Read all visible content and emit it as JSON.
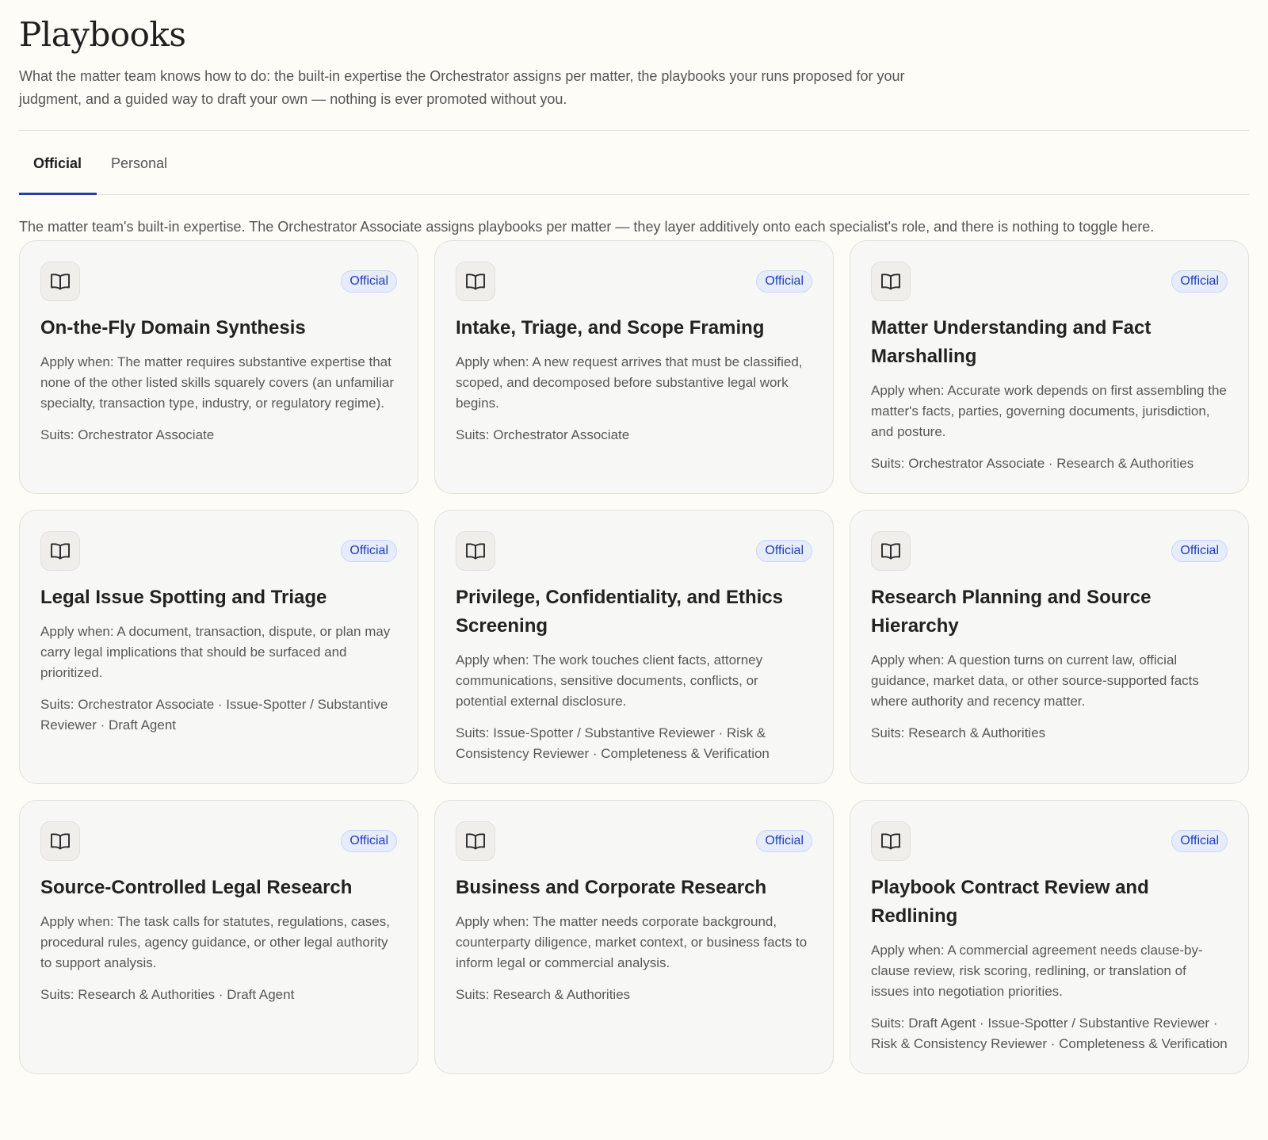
{
  "header": {
    "title": "Playbooks",
    "description": "What the matter team knows how to do: the built-in expertise the Orchestrator assigns per matter, the playbooks your runs proposed for your judgment, and a guided way to draft your own — nothing is ever promoted without you."
  },
  "tabs": [
    {
      "label": "Official",
      "active": true
    },
    {
      "label": "Personal",
      "active": false
    }
  ],
  "section": {
    "description": "The matter team's built-in expertise. The Orchestrator Associate assigns playbooks per matter — they layer additively onto each specialist's role, and there is nothing to toggle here."
  },
  "colors": {
    "accent": "#1f3fb0",
    "badge_bg": "#e6ecfb",
    "page_bg": "#fdfcf7",
    "card_bg": "#f7f7f5"
  },
  "cards": [
    {
      "icon": "book-icon",
      "badge": "Official",
      "title": "On-the-Fly Domain Synthesis",
      "apply": "Apply when: The matter requires substantive expertise that none of the other listed skills squarely covers (an unfamiliar specialty, transaction type, industry, or regulatory regime).",
      "suits": "Suits: Orchestrator Associate"
    },
    {
      "icon": "book-icon",
      "badge": "Official",
      "title": "Intake, Triage, and Scope Framing",
      "apply": "Apply when: A new request arrives that must be classified, scoped, and decomposed before substantive legal work begins.",
      "suits": "Suits: Orchestrator Associate"
    },
    {
      "icon": "book-icon",
      "badge": "Official",
      "title": "Matter Understanding and Fact Marshalling",
      "apply": "Apply when: Accurate work depends on first assembling the matter's facts, parties, governing documents, jurisdiction, and posture.",
      "suits": "Suits: Orchestrator Associate · Research & Authorities"
    },
    {
      "icon": "book-icon",
      "badge": "Official",
      "title": "Legal Issue Spotting and Triage",
      "apply": "Apply when: A document, transaction, dispute, or plan may carry legal implications that should be surfaced and prioritized.",
      "suits": "Suits: Orchestrator Associate · Issue-Spotter / Substantive Reviewer · Draft Agent"
    },
    {
      "icon": "book-icon",
      "badge": "Official",
      "title": "Privilege, Confidentiality, and Ethics Screening",
      "apply": "Apply when: The work touches client facts, attorney communications, sensitive documents, conflicts, or potential external disclosure.",
      "suits": "Suits: Issue-Spotter / Substantive Reviewer · Risk & Consistency Reviewer · Completeness & Verification"
    },
    {
      "icon": "book-icon",
      "badge": "Official",
      "title": "Research Planning and Source Hierarchy",
      "apply": "Apply when: A question turns on current law, official guidance, market data, or other source-supported facts where authority and recency matter.",
      "suits": "Suits: Research & Authorities"
    },
    {
      "icon": "book-icon",
      "badge": "Official",
      "title": "Source-Controlled Legal Research",
      "apply": "Apply when: The task calls for statutes, regulations, cases, procedural rules, agency guidance, or other legal authority to support analysis.",
      "suits": "Suits: Research & Authorities · Draft Agent"
    },
    {
      "icon": "book-icon",
      "badge": "Official",
      "title": "Business and Corporate Research",
      "apply": "Apply when: The matter needs corporate background, counterparty diligence, market context, or business facts to inform legal or commercial analysis.",
      "suits": "Suits: Research & Authorities"
    },
    {
      "icon": "book-icon",
      "badge": "Official",
      "title": "Playbook Contract Review and Redlining",
      "apply": "Apply when: A commercial agreement needs clause-by-clause review, risk scoring, redlining, or translation of issues into negotiation priorities.",
      "suits": "Suits: Draft Agent · Issue-Spotter / Substantive Reviewer · Risk & Consistency Reviewer · Completeness & Verification"
    }
  ]
}
